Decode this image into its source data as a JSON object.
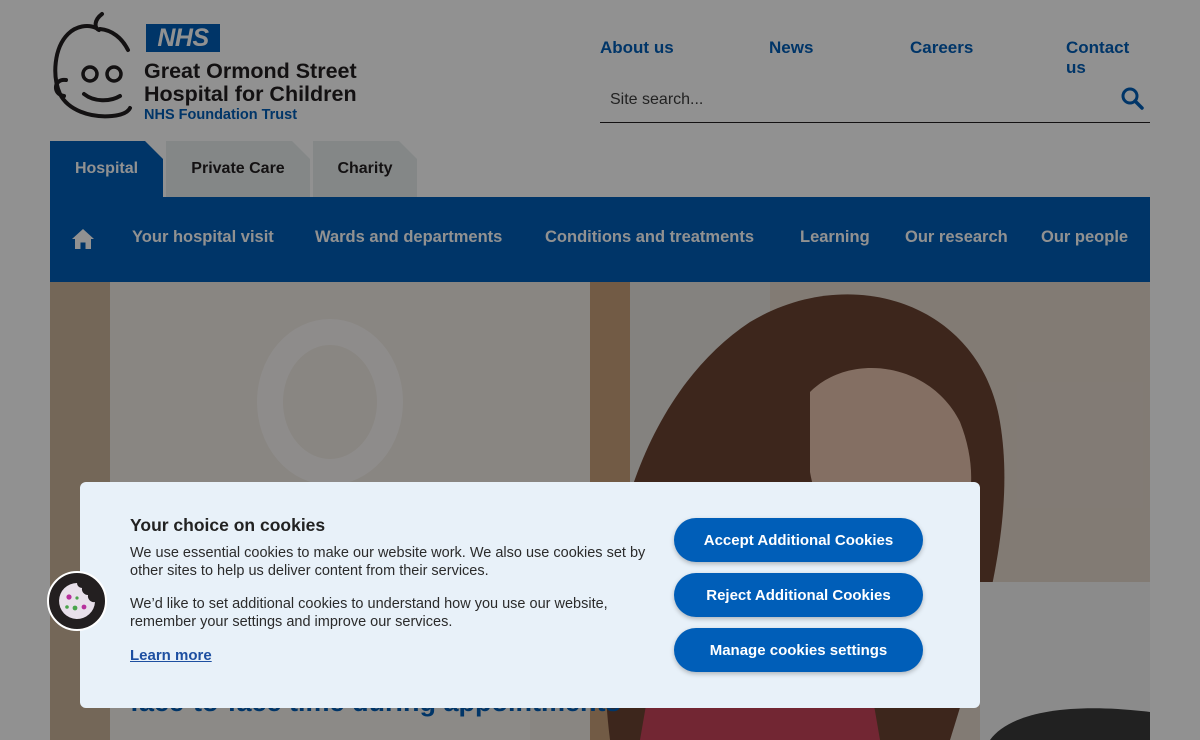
{
  "brand": {
    "nhs_badge": "NHS",
    "name_line1": "Great Ormond Street",
    "name_line2": "Hospital for Children",
    "trust": "NHS Foundation Trust",
    "accent_color": "#005eb8"
  },
  "top_links": [
    {
      "label": "About us"
    },
    {
      "label": "News"
    },
    {
      "label": "Careers"
    },
    {
      "label": "Contact us"
    }
  ],
  "search": {
    "placeholder": "Site search...",
    "value": "",
    "icon": "search-icon"
  },
  "site_tabs": [
    {
      "label": "Hospital",
      "active": true
    },
    {
      "label": "Private Care",
      "active": false
    },
    {
      "label": "Charity",
      "active": false
    }
  ],
  "main_nav": {
    "home_icon": "home-icon",
    "items": [
      {
        "label": "Your hospital visit"
      },
      {
        "label": "Wards and departments"
      },
      {
        "label": "Conditions and treatments"
      },
      {
        "label": "Learning"
      },
      {
        "label": "Our research"
      },
      {
        "label": "Our people"
      }
    ]
  },
  "hero": {
    "caption": "face-to-face time during appointments"
  },
  "cookie_banner": {
    "title": "Your choice on cookies",
    "paragraph1": "We use essential cookies to make our website work. We also use cookies set by other sites to help us deliver content from their services.",
    "paragraph2": "We’d like to set additional cookies to understand how you use our website, remember your settings and improve our services.",
    "learn_more": "Learn more",
    "accept_label": "Accept Additional Cookies",
    "reject_label": "Reject Additional Cookies",
    "manage_label": "Manage cookies settings",
    "badge_icon": "cookie-icon"
  }
}
